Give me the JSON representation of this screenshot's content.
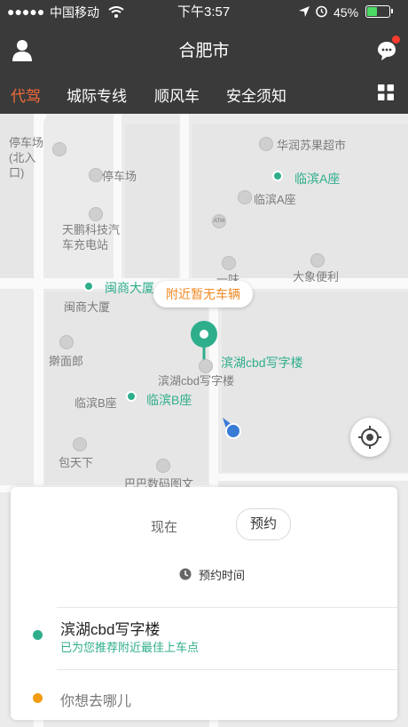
{
  "status_bar": {
    "carrier": "中国移动",
    "time": "下午3:57",
    "battery": "45%"
  },
  "header": {
    "title": "合肥市"
  },
  "tabs": [
    {
      "label": "代驾"
    },
    {
      "label": "城际专线"
    },
    {
      "label": "顺风车"
    },
    {
      "label": "安全须知"
    }
  ],
  "map": {
    "labels": {
      "parking_north": "停车场(北入口)",
      "parking": "停车场",
      "supermarket": "华润苏果超市",
      "linbin_a_green": "临滨A座",
      "linbin_a": "临滨A座",
      "charging": "天鹏科技汽车充电站",
      "atm": "ATM",
      "yiwei": "一味",
      "daxiang": "大象便利",
      "minshang_green": "闽商大厦",
      "minshang": "闽商大厦",
      "binhu_green": "滨湖cbd写字楼",
      "binhu": "滨湖cbd写字楼",
      "janmianlang": "擀面郎",
      "linbin_b_green": "临滨B座",
      "linbin_b": "临滨B座",
      "baotianxia": "包天下",
      "baba": "巴巴数码图文"
    },
    "tooltip": "附近暂无车辆"
  },
  "card": {
    "mode_now": "现在",
    "mode_reserve": "预约",
    "reserve_time": "预约时间",
    "pickup": "滨湖cbd写字楼",
    "pickup_hint": "已为您推荐附近最佳上车点",
    "destination_placeholder": "你想去哪儿"
  },
  "colors": {
    "accent_green": "#2fae8c",
    "accent_orange": "#f46a3a",
    "dest_dot": "#f39c12",
    "header_bg": "#3a3a3a"
  }
}
